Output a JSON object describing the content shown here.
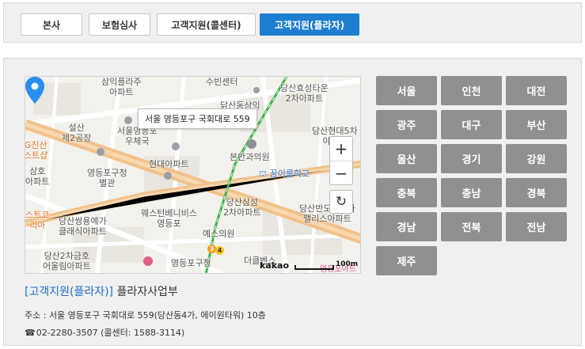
{
  "tabs": [
    {
      "label": "본사",
      "active": false
    },
    {
      "label": "보험심사",
      "active": false
    },
    {
      "label": "고객지원(콜센터)",
      "active": false
    },
    {
      "label": "고객지원(플라자)",
      "active": true
    }
  ],
  "map": {
    "tooltip": "서울 영등포구 국회대로 559",
    "labels": {
      "l1": "삼익플라주\n아파트",
      "l2": "수빈센터",
      "l3": "당산효성타운\n2차아파트",
      "l4": "서울영등포\n우체국",
      "l5": "닭산동삼익\n아파트",
      "l6": "설산\n제2공장",
      "l7": "당산현대5차\n아파트",
      "l8": "G진산\n스트샵",
      "l9": "현대아파트",
      "l10": "본안과의원",
      "l11": "꿈이룸학교",
      "l12": "영등포구청\n별관",
      "l13": "삼호\n아파트",
      "l14": "웨스턴베니비스\n영등포",
      "l15": "당산삼성\n2차아파트",
      "l16": "당산반도유보라\n팰리스아파트",
      "l17": "스트코\n리아",
      "l18": "당산쌍용예가\n클래식아파트",
      "l19": "예스의원",
      "l20": "당산2차금호\n어울림아파트",
      "l21": "영등포구청",
      "l22": "더클벤스",
      "l23": "영등포아트"
    },
    "zoom_in": "+",
    "zoom_out": "−",
    "reset": "↻",
    "brand": "kakao",
    "scale": "100m",
    "subway_badges": [
      "3",
      "4"
    ]
  },
  "office": {
    "category": "[고객지원(플라자)]",
    "name": "플라자사업부",
    "address": "주소 : 서울 영등포구 국회대로 559(당산동4가, 에이원타워) 10층",
    "phone_icon": "☎",
    "phone": "02-2280-3507 (콜센터: 1588-3114)"
  },
  "regions": [
    "서울",
    "인천",
    "대전",
    "광주",
    "대구",
    "부산",
    "울산",
    "경기",
    "강원",
    "충북",
    "충남",
    "경북",
    "경남",
    "전북",
    "전남",
    "제주"
  ],
  "colors": {
    "active_tab": "#1e7fd0",
    "region_button": "#909090",
    "link_blue": "#1e6fc8",
    "road_orange": "#f2c18a",
    "subway_green": "#3cb44a"
  }
}
